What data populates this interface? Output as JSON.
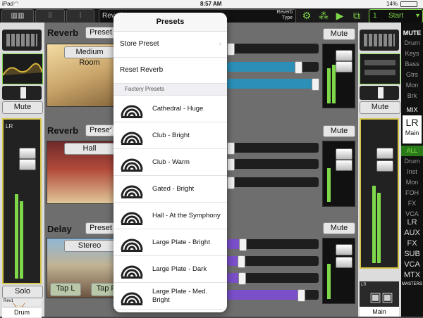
{
  "status": {
    "device": "iPad",
    "time": "8:57 AM",
    "battery": "14%"
  },
  "toolbar": {
    "fx_name": "Reverb",
    "fx_type_label": "Reverb",
    "fx_type_sub": "Type",
    "start_num": "1",
    "start_label": "Start"
  },
  "left_strip": {
    "mute_label": "Mute",
    "solo_label": "Solo",
    "channel_name": "Drum",
    "meter_label": "LR",
    "small_label": "Rev1"
  },
  "rows": [
    {
      "title": "Reverb",
      "preset_label": "Preset",
      "image_label": "Medium Room",
      "mute_label": "Mute",
      "fills": [
        0.0,
        0.78,
        1.0
      ],
      "color": "#2b8fb8"
    },
    {
      "title": "Reverb",
      "preset_label": "Preset",
      "image_label": "Hall",
      "mute_label": "Mute",
      "fills": [
        0.02,
        0.04,
        0.02
      ],
      "color": "#2b8fb8"
    },
    {
      "title": "Delay",
      "preset_label": "Preset",
      "image_label": "Stereo",
      "mute_label": "Mute",
      "fills": [
        0.17,
        0.15,
        0.16,
        0.81
      ],
      "color": "#7a4fc9",
      "tap_left": "Tap L",
      "tap_right": "Tap R"
    }
  ],
  "right_strip": {
    "mute_label": "Mute",
    "mix_label": "MIX",
    "lr_label": "LR",
    "main_label": "Main",
    "channel_name": "Main",
    "lr_small": "LR"
  },
  "right_sidebar": {
    "mute_header": "MUTE",
    "mute_items": [
      "Drum",
      "Keys",
      "Bass",
      "Gtrs",
      "Mon",
      "Brk"
    ],
    "mix_items": [
      "ALL",
      "Drum",
      "Inst",
      "Mon",
      "FOH",
      "FX",
      "VCA"
    ],
    "bottom_items": [
      "LR",
      "AUX",
      "FX",
      "SUB",
      "VCA",
      "MTX"
    ],
    "masters_label": "MASTERS"
  },
  "popover": {
    "title": "Presets",
    "store_label": "Store Preset",
    "reset_label": "Reset Reverb",
    "section_label": "Factory Presets",
    "presets": [
      "Cathedral - Huge",
      "Club - Bright",
      "Club - Warm",
      "Gated - Bright",
      "Hall - At the Symphony",
      "Large Plate - Bright",
      "Large Plate - Dark",
      "Large Plate - Med. Bright"
    ]
  },
  "colors": {
    "accent_green": "#7fd84a",
    "fx_blue": "#2b8fb8",
    "delay_purple": "#7a4fc9"
  }
}
